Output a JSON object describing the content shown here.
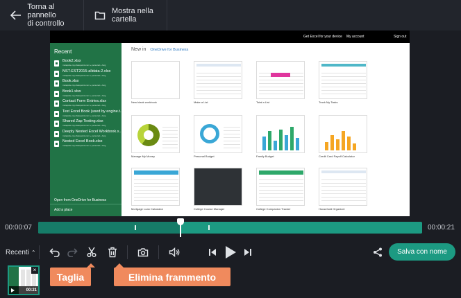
{
  "header": {
    "back_label_line1": "Torna al pannello",
    "back_label_line2": "di controllo",
    "folder_label_line1": "Mostra nella",
    "folder_label_line2": "cartella"
  },
  "preview": {
    "top_links": [
      "Get Excel for your device",
      "My account",
      "Sign out"
    ],
    "sidebar_title": "Recent",
    "recent_files": [
      {
        "name": "Book2.xlsx",
        "path": "mstapsite-my.sharepoint.com » personal » forg"
      },
      {
        "name": "NST-EST2015-alldata-2.xlsx",
        "path": "mstapsite-my.sharepoint.com » personal » forg"
      },
      {
        "name": "Book.xlsx",
        "path": "mstapsite-my.sharepoint.com » personal » forg"
      },
      {
        "name": "Book1.xlsx",
        "path": "mstapsite-my.sharepoint.com » personal » forg"
      },
      {
        "name": "Contact Form Entries.xlsx",
        "path": "mstapsite-my.sharepoint.com » personal » forg"
      },
      {
        "name": "Test Excel Book (used by engine.t...",
        "path": "mstapsite-my.sharepoint.com » personal » forg"
      },
      {
        "name": "Shared Zap Testing.xlsx",
        "path": "mstapsite-my.sharepoint.com » personal » forg"
      },
      {
        "name": "Deeply Nested Excel Workbook.x...",
        "path": "mstapsite-my.sharepoint.com » personal » forg"
      },
      {
        "name": "Nested Excel Book.xlsx",
        "path": "mstapsite-my.sharepoint.com » personal » forg"
      }
    ],
    "open_onedrive": "Open from OneDrive for Business",
    "add_place": "Add a place",
    "new_in": "New in",
    "onedrive": "OneDrive for Business",
    "templates": [
      "New blank workbook",
      "Make a List",
      "Total a List",
      "Track My Tasks",
      "Manage My Money",
      "Personal Budget",
      "Family Budget",
      "Credit Card Payoff Calculator",
      "Mortgage Loan Calculator",
      "College Course Manager",
      "College Companion Tracker",
      "Household Organizer"
    ]
  },
  "timeline": {
    "current_time": "00:00:07",
    "total_time": "00:00:21",
    "played_fraction": 0.37
  },
  "controls": {
    "recent_label": "Recenti",
    "save_label": "Salva con nome"
  },
  "clip": {
    "duration": "00:21"
  },
  "tooltips": {
    "cut": "Taglia",
    "delete_fragment": "Elimina frammento"
  },
  "colors": {
    "accent": "#1c9a82",
    "tooltip": "#f08a5d",
    "excel_green": "#217346"
  }
}
